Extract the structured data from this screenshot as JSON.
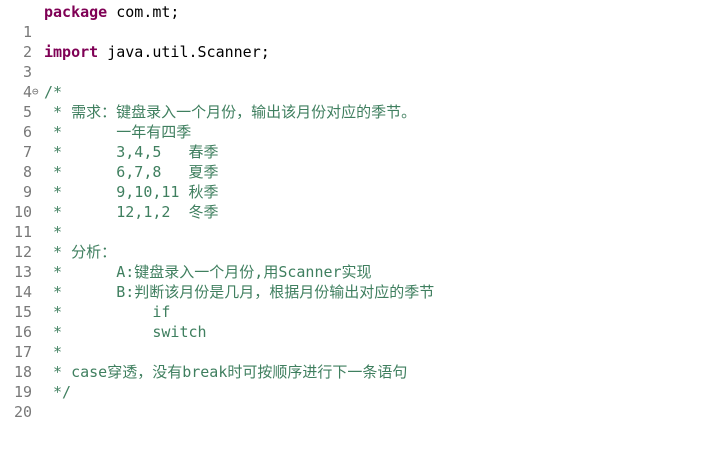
{
  "editor": {
    "colors": {
      "keyword": "#7f0055",
      "comment": "#3f7f5f",
      "line_number": "#787878",
      "text": "#000000"
    },
    "fold_icon": "collapse-minus-icon",
    "lines": [
      {
        "num": "1",
        "kw": "package",
        "text": " com.mt;"
      },
      {
        "num": "2",
        "text": ""
      },
      {
        "num": "3",
        "kw": "import",
        "text": " java.util.Scanner;"
      },
      {
        "num": "4",
        "text": ""
      },
      {
        "num": "5",
        "comment": "/*",
        "fold": "⊖"
      },
      {
        "num": "6",
        "comment": " * 需求：键盘录入一个月份，输出该月份对应的季节。"
      },
      {
        "num": "7",
        "comment": " *      一年有四季"
      },
      {
        "num": "8",
        "comment": " *      3,4,5   春季"
      },
      {
        "num": "9",
        "comment": " *      6,7,8   夏季"
      },
      {
        "num": "10",
        "comment": " *      9,10,11 秋季"
      },
      {
        "num": "11",
        "comment": " *      12,1,2  冬季"
      },
      {
        "num": "12",
        "comment": " *"
      },
      {
        "num": "13",
        "comment": " * 分析："
      },
      {
        "num": "14",
        "comment": " *      A:键盘录入一个月份,用Scanner实现"
      },
      {
        "num": "15",
        "comment": " *      B:判断该月份是几月，根据月份输出对应的季节"
      },
      {
        "num": "16",
        "comment": " *          if"
      },
      {
        "num": "17",
        "comment": " *          switch"
      },
      {
        "num": "18",
        "comment": " *"
      },
      {
        "num": "19",
        "comment": " * case穿透，没有break时可按顺序进行下一条语句"
      },
      {
        "num": "20",
        "comment": " */"
      }
    ]
  }
}
